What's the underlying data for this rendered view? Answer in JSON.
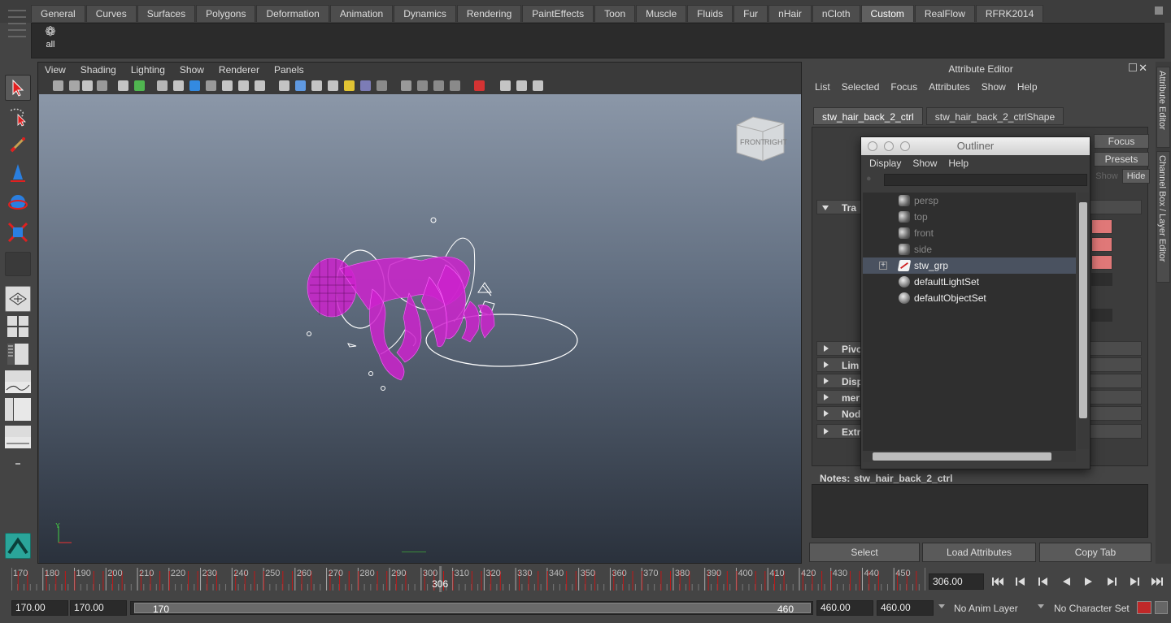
{
  "shelf": {
    "tabs": [
      "General",
      "Curves",
      "Surfaces",
      "Polygons",
      "Deformation",
      "Animation",
      "Dynamics",
      "Rendering",
      "PaintEffects",
      "Toon",
      "Muscle",
      "Fluids",
      "Fur",
      "nHair",
      "nCloth",
      "Custom",
      "RealFlow",
      "RFRK2014"
    ],
    "active_tab": "Custom",
    "item_label": "all"
  },
  "viewport": {
    "menu": [
      "View",
      "Shading",
      "Lighting",
      "Show",
      "Renderer",
      "Panels"
    ],
    "viewcube_labels": [
      "FRONT",
      "RIGHT"
    ]
  },
  "attribute_editor": {
    "title": "Attribute Editor",
    "menu": [
      "List",
      "Selected",
      "Focus",
      "Attributes",
      "Show",
      "Help"
    ],
    "tabs": [
      "stw_hair_back_2_ctrl",
      "stw_hair_back_2_ctrlShape"
    ],
    "focus_label": "Focus",
    "presets_label": "Presets",
    "show_label": "Show",
    "hide_label": "Hide",
    "sections": [
      "Tra",
      "Pivo",
      "Lim",
      "Disp",
      "mer",
      "Nod",
      "Extr"
    ],
    "notes_label": "Notes:",
    "notes_node": "stw_hair_back_2_ctrl",
    "buttons": [
      "Select",
      "Load Attributes",
      "Copy Tab"
    ],
    "side_tabs": [
      "Attribute Editor",
      "Channel Box / Layer Editor"
    ]
  },
  "outliner": {
    "title": "Outliner",
    "menu": [
      "Display",
      "Show",
      "Help"
    ],
    "items": [
      {
        "label": "persp",
        "icon": "camera-icon",
        "dim": true
      },
      {
        "label": "top",
        "icon": "camera-icon",
        "dim": true
      },
      {
        "label": "front",
        "icon": "camera-icon",
        "dim": true
      },
      {
        "label": "side",
        "icon": "camera-icon",
        "dim": true
      },
      {
        "label": "stw_grp",
        "icon": "group-icon",
        "dim": false,
        "selected": true,
        "expandable": true
      },
      {
        "label": "defaultLightSet",
        "icon": "set-icon",
        "dim": false
      },
      {
        "label": "defaultObjectSet",
        "icon": "set-icon",
        "dim": false
      }
    ]
  },
  "timeline": {
    "ticks": [
      "170",
      "180",
      "190",
      "200",
      "210",
      "220",
      "230",
      "240",
      "250",
      "260",
      "270",
      "280",
      "290",
      "300",
      "310",
      "320",
      "330",
      "340",
      "350",
      "360",
      "370",
      "380",
      "390",
      "400",
      "410",
      "420",
      "430",
      "440",
      "450"
    ],
    "current_frame_label": "306",
    "current_time": "306.00"
  },
  "range": {
    "start": "170.00",
    "playback_start": "170.00",
    "slider_start": "170",
    "slider_end": "460",
    "playback_end": "460.00",
    "end": "460.00",
    "anim_layer": "No Anim Layer",
    "character_set": "No Character Set"
  },
  "colors": {
    "selected_object": "#cc22cc",
    "attribute_swatch": "#e07878",
    "key_tick": "#c01818"
  }
}
